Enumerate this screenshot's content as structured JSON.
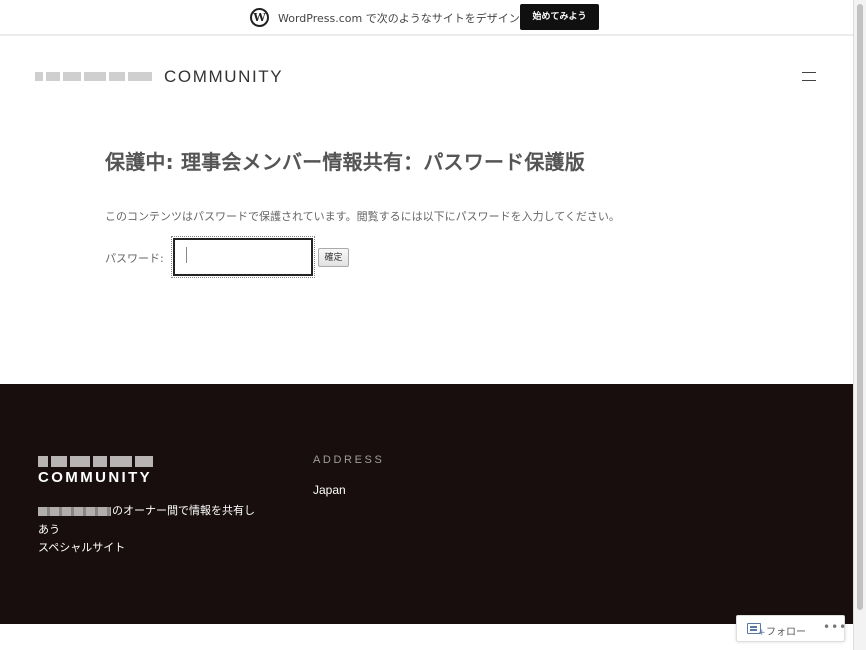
{
  "topbar": {
    "logo_glyph": "W",
    "promo_text": "WordPress.com で次のようなサイトをデザイン",
    "cta_label": "始めてみよう"
  },
  "header": {
    "site_title": "COMMUNITY",
    "menu_icon": "hamburger-menu-icon"
  },
  "main": {
    "page_title": "保護中: 理事会メンバー情報共有：パスワード保護版",
    "notice": "このコンテンツはパスワードで保護されています。閲覧するには以下にパスワードを入力してください。",
    "password_label": "パスワード:",
    "password_value": "",
    "submit_label": "確定"
  },
  "footer": {
    "site_title": "COMMUNITY",
    "description_suffix": "のオーナー間で情報を共有し",
    "description_line2": "あう",
    "description_line3": "スペシャルサイト",
    "address_heading": "ADDRESS",
    "address_value": "Japan",
    "background_color": "#180e0e"
  },
  "follow_widget": {
    "label": "フォロー",
    "more_glyph": "•••",
    "plus_glyph": "+"
  }
}
